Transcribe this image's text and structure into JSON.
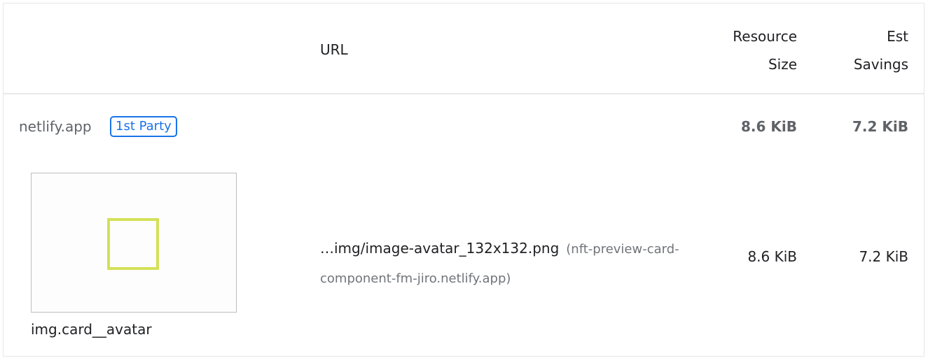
{
  "header": {
    "url": "URL",
    "resource_size_line1": "Resource",
    "resource_size_line2": "Size",
    "est_savings_line1": "Est",
    "est_savings_line2": "Savings"
  },
  "group": {
    "host": "netlify.app",
    "badge": "1st Party",
    "resource_size": "8.6 KiB",
    "est_savings": "7.2 KiB"
  },
  "item": {
    "node_label": "img.card__avatar",
    "url_path": "…img/image-avatar_132x132.png",
    "url_host": "(nft-preview-card-component-fm-jiro.netlify.app)",
    "resource_size": "8.6 KiB",
    "est_savings": "7.2 KiB",
    "thumb_outline_color": "#d4e157"
  },
  "colors": {
    "badge": "#1a73e8",
    "muted_text": "#5f6368"
  }
}
